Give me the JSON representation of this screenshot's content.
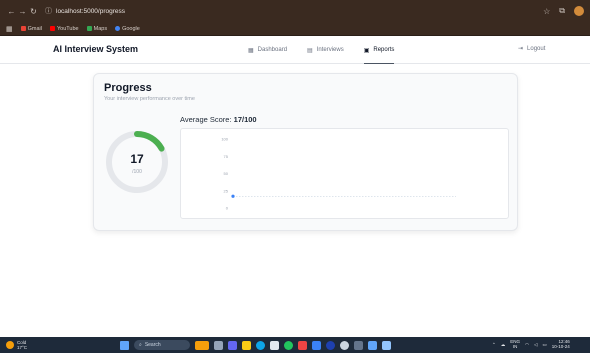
{
  "browser": {
    "url": "localhost:5000/progress",
    "bookmarks": [
      {
        "label": "Gmail",
        "color": "#ea4335"
      },
      {
        "label": "YouTube",
        "color": "#ff0000"
      },
      {
        "label": "Maps",
        "color": "#34a853"
      },
      {
        "label": "Google",
        "color": "#4285f4"
      }
    ]
  },
  "app": {
    "brand": "AI Interview System",
    "nav": [
      {
        "label": "Dashboard",
        "icon": "grid-icon",
        "active": false
      },
      {
        "label": "Interviews",
        "icon": "document-icon",
        "active": false
      },
      {
        "label": "Reports",
        "icon": "report-icon",
        "active": true
      }
    ],
    "logout": "Logout"
  },
  "progress": {
    "title": "Progress",
    "subtitle": "Your interview performance over time",
    "score_value": "17",
    "score_max": "/100",
    "score_fraction": 0.17,
    "avg_label": "Average Score: ",
    "avg_value": "17/100",
    "ring_color": "#4caf50",
    "ring_track_color": "#e5e7eb"
  },
  "chart_data": {
    "type": "line",
    "yticks": [
      "100",
      "75",
      "50",
      "25",
      "0"
    ],
    "ylim": [
      0,
      100
    ],
    "x": [
      0
    ],
    "series": [
      {
        "values": [
          17
        ]
      }
    ],
    "grid": true,
    "point_color": "#3b82f6"
  },
  "taskbar": {
    "weather_temp": "Cold",
    "weather_desc": "17°C",
    "search_placeholder": "Search",
    "lang_top": "ENG",
    "lang_bottom": "IN",
    "time": "12:46",
    "date": "10-10-24"
  }
}
